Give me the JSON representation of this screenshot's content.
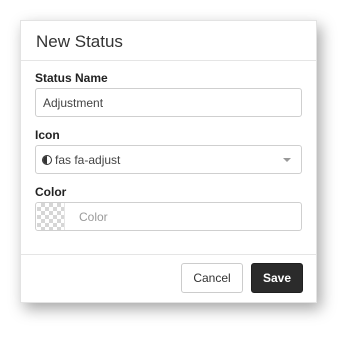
{
  "dialog": {
    "title": "New Status"
  },
  "form": {
    "status_name": {
      "label": "Status Name",
      "value": "Adjustment"
    },
    "icon": {
      "label": "Icon",
      "selected": "fas fa-adjust",
      "icon_name": "adjust-icon"
    },
    "color": {
      "label": "Color",
      "placeholder": "Color"
    }
  },
  "footer": {
    "cancel_label": "Cancel",
    "save_label": "Save"
  },
  "colors": {
    "save_button_bg": "#2b2b2b",
    "border": "#cfcfcf"
  }
}
